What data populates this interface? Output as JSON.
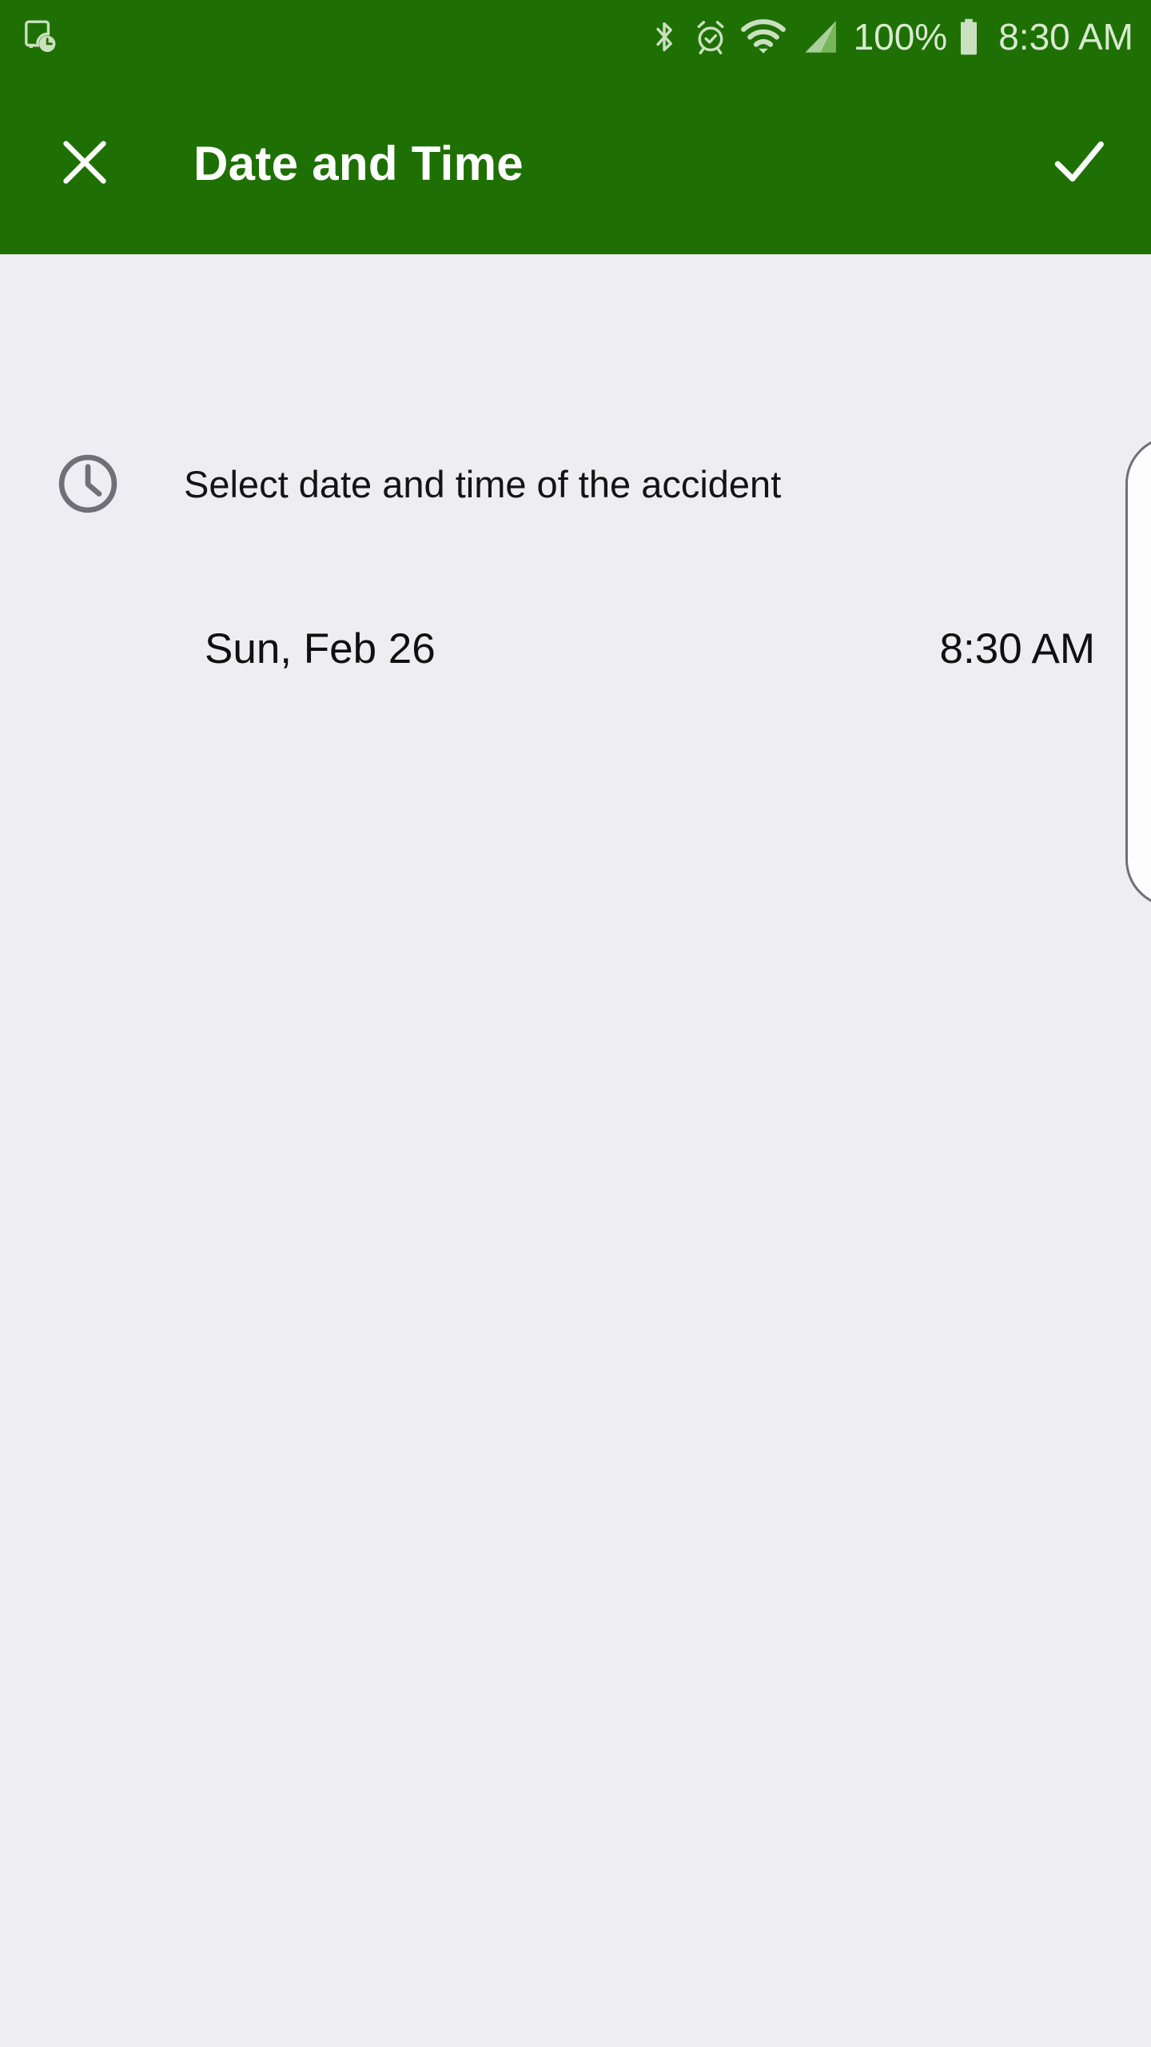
{
  "colors": {
    "app_bar_green": "#1f7004",
    "content_background": "#eeeef2",
    "status_icon_tint": "#d9ead1",
    "primary_text": "#101010",
    "icon_gray": "#6f6f75"
  },
  "status_bar": {
    "left_icons": [
      {
        "name": "screenshot-clock-icon",
        "label": "Scheduled screenshot"
      }
    ],
    "right_icons": [
      {
        "name": "bluetooth-icon",
        "label": "Bluetooth"
      },
      {
        "name": "alarm-icon",
        "label": "Alarm set"
      },
      {
        "name": "wifi-icon",
        "label": "Wi-Fi"
      },
      {
        "name": "cellular-signal-icon",
        "label": "Cellular signal"
      },
      {
        "name": "battery-icon",
        "label": "Battery full"
      }
    ],
    "battery_percent": "100%",
    "clock": "8:30 AM"
  },
  "app_bar": {
    "close_icon": "close-icon",
    "title": "Date and Time",
    "confirm_icon": "check-icon"
  },
  "content": {
    "prompt": {
      "icon": "clock-icon",
      "label": "Select date and time of the accident"
    },
    "datetime": {
      "date": "Sun, Feb 26",
      "time": "8:30 AM"
    }
  }
}
